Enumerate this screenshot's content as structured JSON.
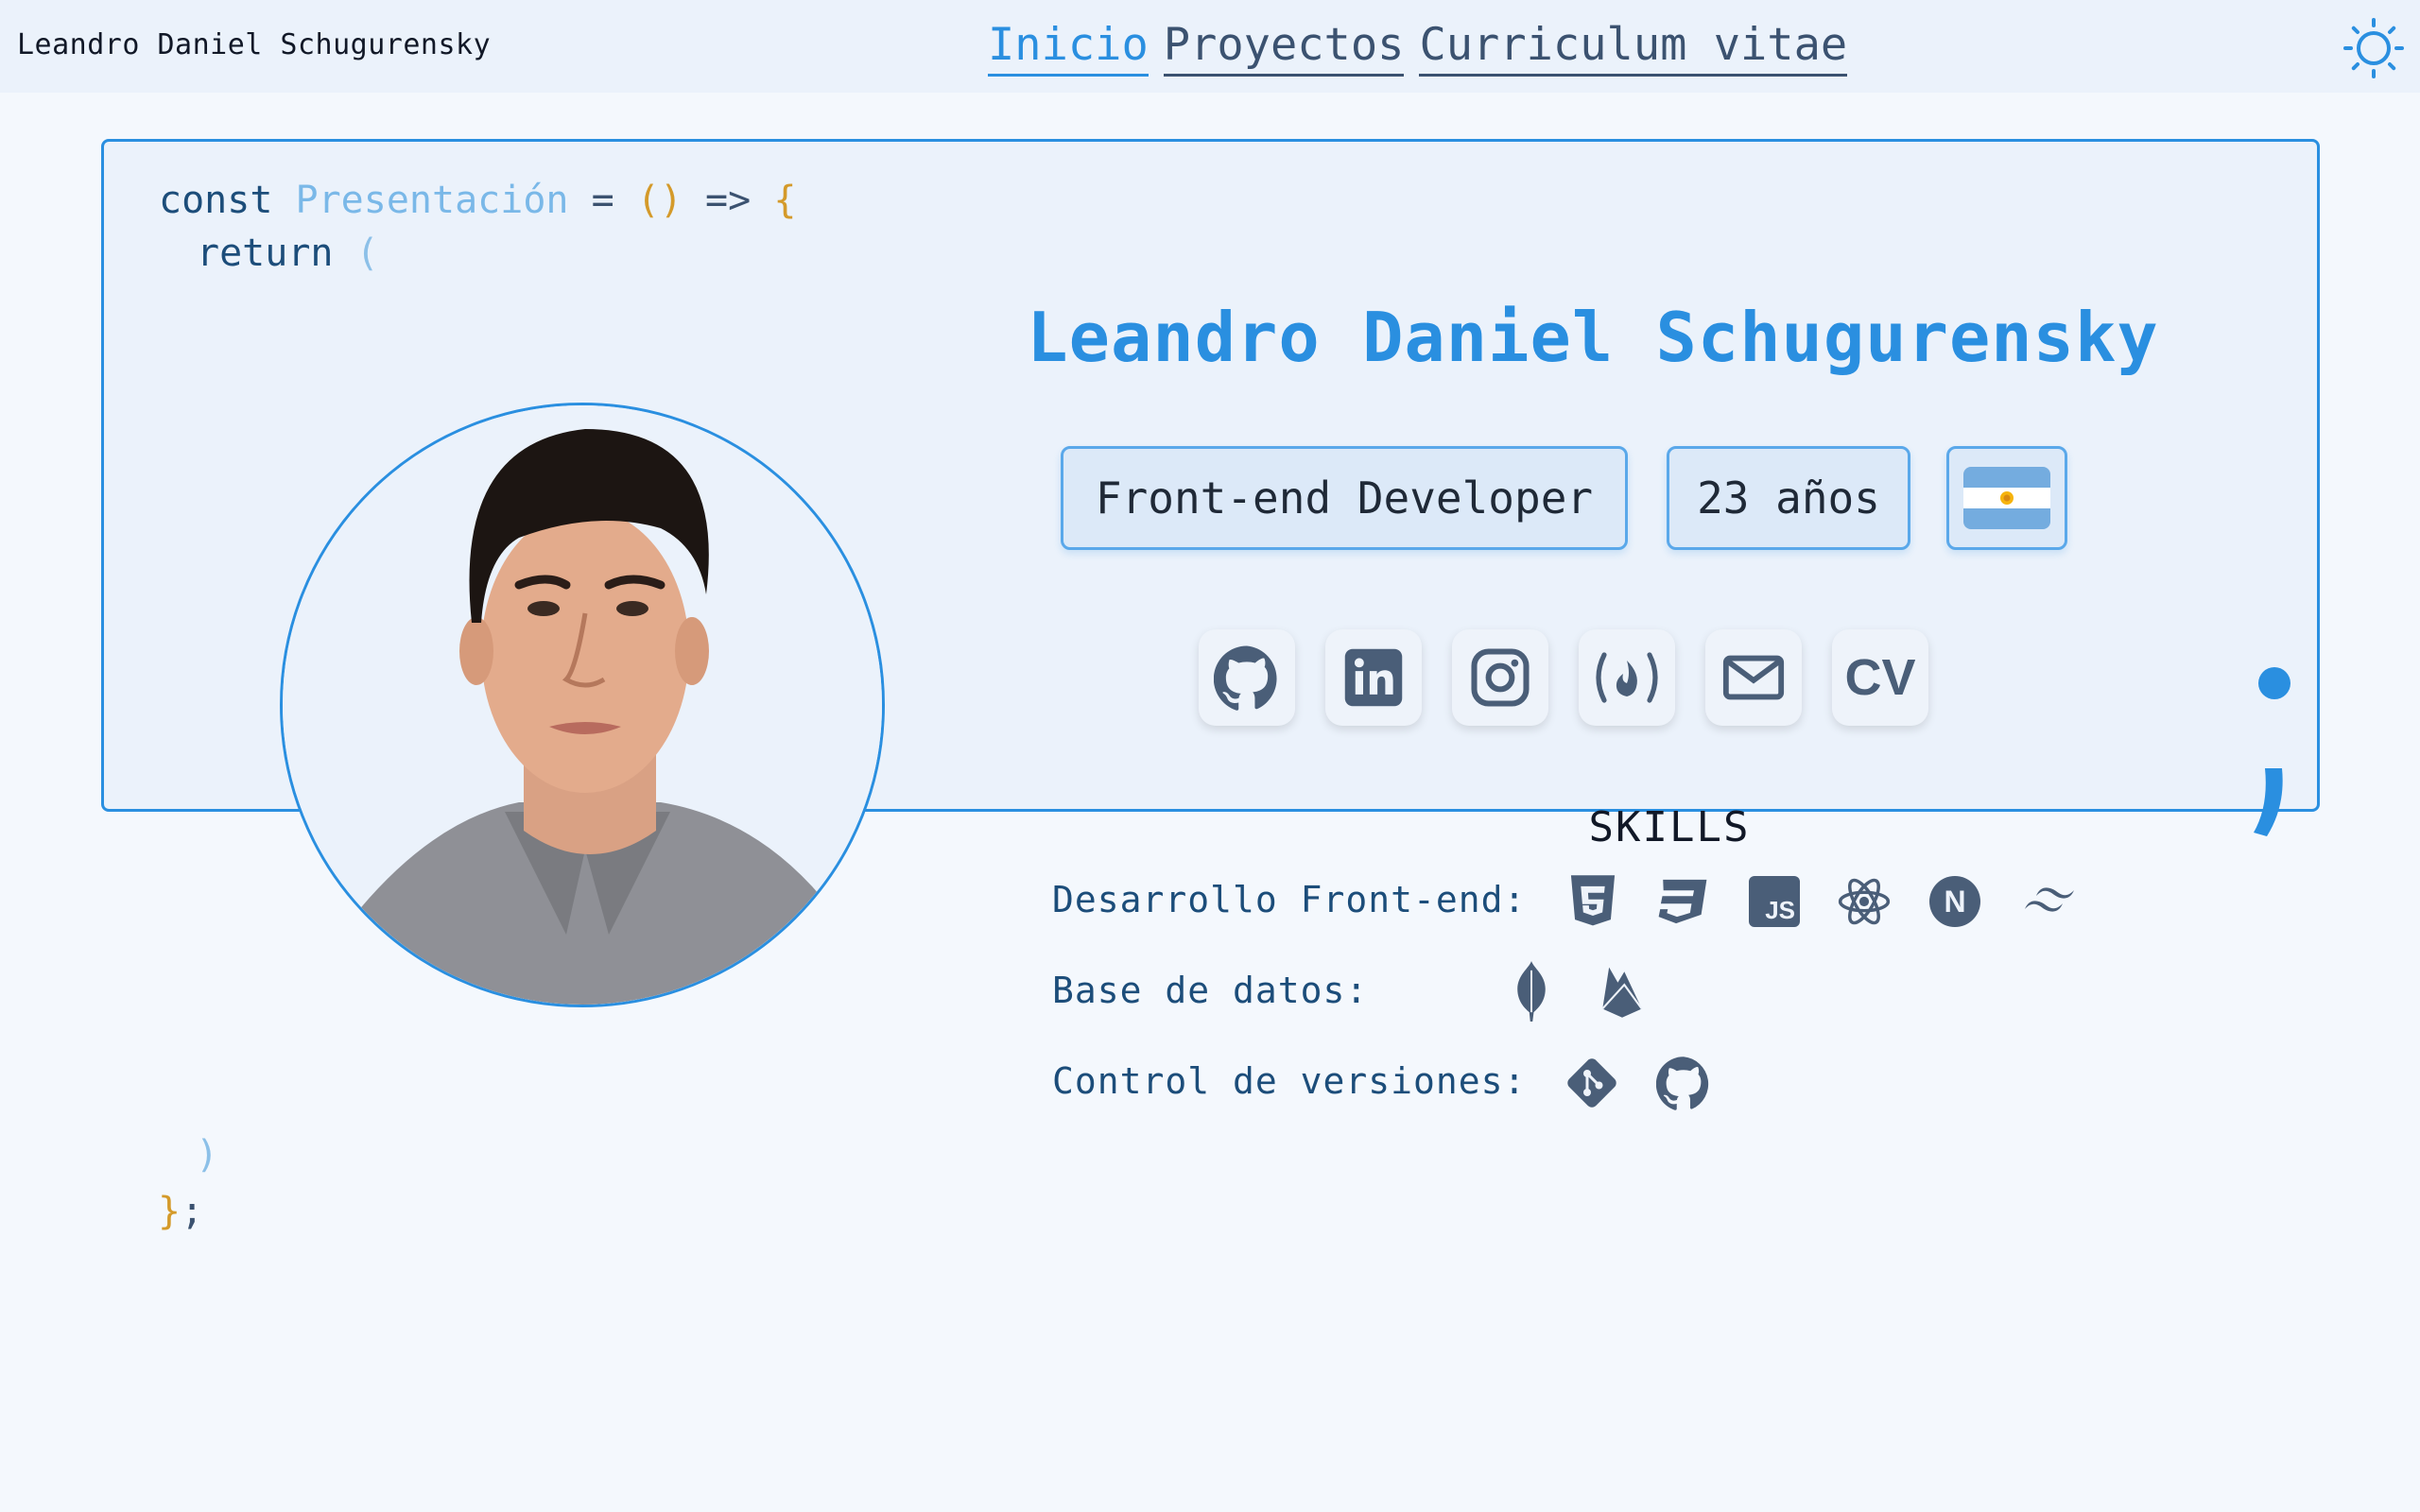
{
  "header": {
    "brand": "Leandro Daniel Schugurensky",
    "nav": [
      "Inicio",
      "Proyectos",
      "Curriculum vitae"
    ]
  },
  "code": {
    "const_kw": "const",
    "fn_name": "Presentación",
    "equals": "=",
    "parens": "()",
    "arrow": "=>",
    "open_brace": "{",
    "return_kw": "return",
    "open_paren": "(",
    "close_paren": ")",
    "close_brace": "}",
    "semicolon": ";"
  },
  "profile": {
    "name": "Leandro Daniel Schugurensky",
    "role": "Front-end Developer",
    "age": "23 años",
    "country_flag": "argentina-flag"
  },
  "social": {
    "github": "github-icon",
    "linkedin": "linkedin-icon",
    "instagram": "instagram-icon",
    "freecodecamp": "freecodecamp-icon",
    "email": "email-icon",
    "cv_label": "CV"
  },
  "skills": {
    "title": "SKILLS",
    "frontend_label": "Desarrollo Front-end:",
    "frontend_icons": [
      "html5-icon",
      "css3-icon",
      "javascript-icon",
      "react-icon",
      "nextjs-icon",
      "tailwind-icon"
    ],
    "js_text": "JS",
    "next_text": "N",
    "db_label": "Base de datos:",
    "db_icons": [
      "mongodb-icon",
      "firebase-icon"
    ],
    "vcs_label": "Control de versiones:",
    "vcs_icons": [
      "git-icon",
      "github-icon"
    ]
  },
  "colors": {
    "accent": "#2a8fe0",
    "icon": "#4a5e78",
    "background": "#f4f8fd",
    "card": "#ebf2fb"
  }
}
